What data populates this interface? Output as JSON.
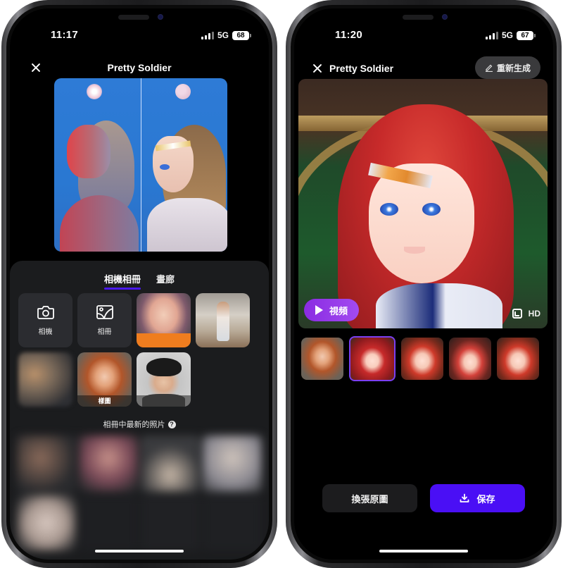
{
  "left_phone": {
    "status_bar": {
      "time": "11:17",
      "network": "5G",
      "battery": "68"
    },
    "header": {
      "title": "Pretty Soldier",
      "close_icon": "close-icon"
    },
    "preview": {
      "description": "before-after comparison image",
      "icon": "comparison-image"
    },
    "sheet": {
      "tabs": [
        {
          "label": "相機相冊",
          "active": true
        },
        {
          "label": "畫廊",
          "active": false
        }
      ],
      "actions": [
        {
          "label": "相機",
          "icon": "camera-icon"
        },
        {
          "label": "相冊",
          "icon": "gallery-icon"
        }
      ],
      "sample_badge": "樣圖",
      "recent_label": "相冊中最新的照片",
      "help_icon": "?"
    }
  },
  "right_phone": {
    "status_bar": {
      "time": "11:20",
      "network": "5G",
      "battery": "67"
    },
    "header": {
      "title": "Pretty Soldier",
      "regenerate_label": "重新生成"
    },
    "result": {
      "video_label": "視頻",
      "hd_label": "HD"
    },
    "thumbnails": [
      {
        "type": "original",
        "selected": false
      },
      {
        "type": "result",
        "selected": true
      },
      {
        "type": "result",
        "selected": false
      },
      {
        "type": "result",
        "selected": false
      },
      {
        "type": "result",
        "selected": false
      }
    ],
    "buttons": {
      "change_original": "換張原圖",
      "save": "保存"
    }
  },
  "colors": {
    "accent_purple": "#4a0ff5",
    "tab_underline": "#4a18f0",
    "video_gradient": "#8a2be2",
    "selected_border": "#7b3ff0"
  }
}
